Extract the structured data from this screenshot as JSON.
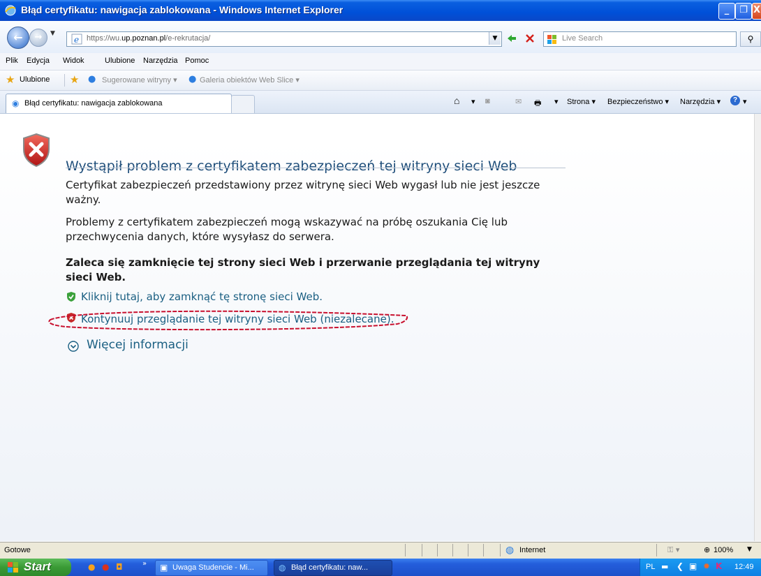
{
  "window": {
    "title": "Błąd certyfikatu: nawigacja zablokowana - Windows Internet Explorer",
    "min_label": "_",
    "max_label": "❐",
    "close_label": "X"
  },
  "address": {
    "url_prefix": "https://wu.",
    "url_domain": "up.poznan.pl",
    "url_suffix": "/e-rekrutacja/",
    "search_placeholder": "Live Search"
  },
  "menu": [
    "Plik",
    "Edycja",
    "Widok",
    "Ulubione",
    "Narzędzia",
    "Pomoc"
  ],
  "favorites": {
    "label": "Ulubione",
    "suggested": "Sugerowane witryny ▾",
    "gallery": "Galeria obiektów Web Slice ▾"
  },
  "tab": {
    "title": "Błąd certyfikatu: nawigacja zablokowana"
  },
  "command_bar": {
    "page": "Strona ▾",
    "security": "Bezpieczeństwo ▾",
    "tools": "Narzędzia ▾"
  },
  "content": {
    "heading": "Wystąpił problem z certyfikatem zabezpieczeń tej witryny sieci Web",
    "para1": "Certyfikat zabezpieczeń przedstawiony przez witrynę sieci Web wygasł lub nie jest jeszcze ważny.",
    "para2": "Problemy z certyfikatem zabezpieczeń mogą wskazywać na próbę oszukania Cię lub przechwycenia danych, które wysyłasz do serwera.",
    "recommendation": "Zaleca się zamknięcie tej strony sieci Web i przerwanie przeglądania tej witryny sieci Web.",
    "close_link": "Kliknij tutaj, aby zamknąć tę stronę sieci Web.",
    "continue_link": "Kontynuuj przeglądanie tej witryny sieci Web (niezalecane).",
    "more_info": "Więcej informacji"
  },
  "status": {
    "text": "Gotowe",
    "zone": "Internet",
    "zoom": "100%"
  },
  "taskbar": {
    "start": "Start",
    "task1": "Uwaga Studencie - Mi...",
    "task2": "Błąd certyfikatu: naw...",
    "lang": "PL",
    "clock": "12:49"
  },
  "colors": {
    "link": "#1a5f82",
    "heading": "#1f4e7a",
    "annotation": "#c8102e"
  }
}
